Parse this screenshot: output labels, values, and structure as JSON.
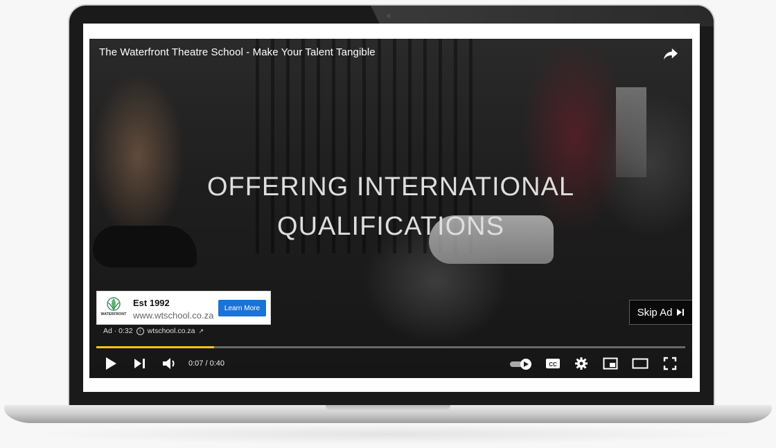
{
  "video": {
    "title": "The Waterfront Theatre School - Make Your Talent Tangible",
    "overlay_line1": "OFFERING INTERNATIONAL",
    "overlay_line2": "QUALIFICATIONS"
  },
  "ad": {
    "logo_text": "WATERFRONT",
    "title": "Est 1992",
    "url": "www.wtschool.co.za",
    "cta_label": "Learn More",
    "label": "Ad · 0:32",
    "site": "wtschool.co.za",
    "skip_label": "Skip Ad"
  },
  "player": {
    "current_time": "0:07",
    "duration": "0:40",
    "time_display": "0:07 / 0:40",
    "progress": 0.2,
    "accent_color": "#f5c518",
    "cta_color": "#1a73d6"
  },
  "icons": [
    "share-icon",
    "play-icon",
    "next-icon",
    "volume-icon",
    "autoplay-toggle-icon",
    "captions-icon",
    "settings-icon",
    "miniplayer-icon",
    "theater-icon",
    "fullscreen-icon",
    "info-icon",
    "external-link-icon",
    "skip-icon"
  ]
}
